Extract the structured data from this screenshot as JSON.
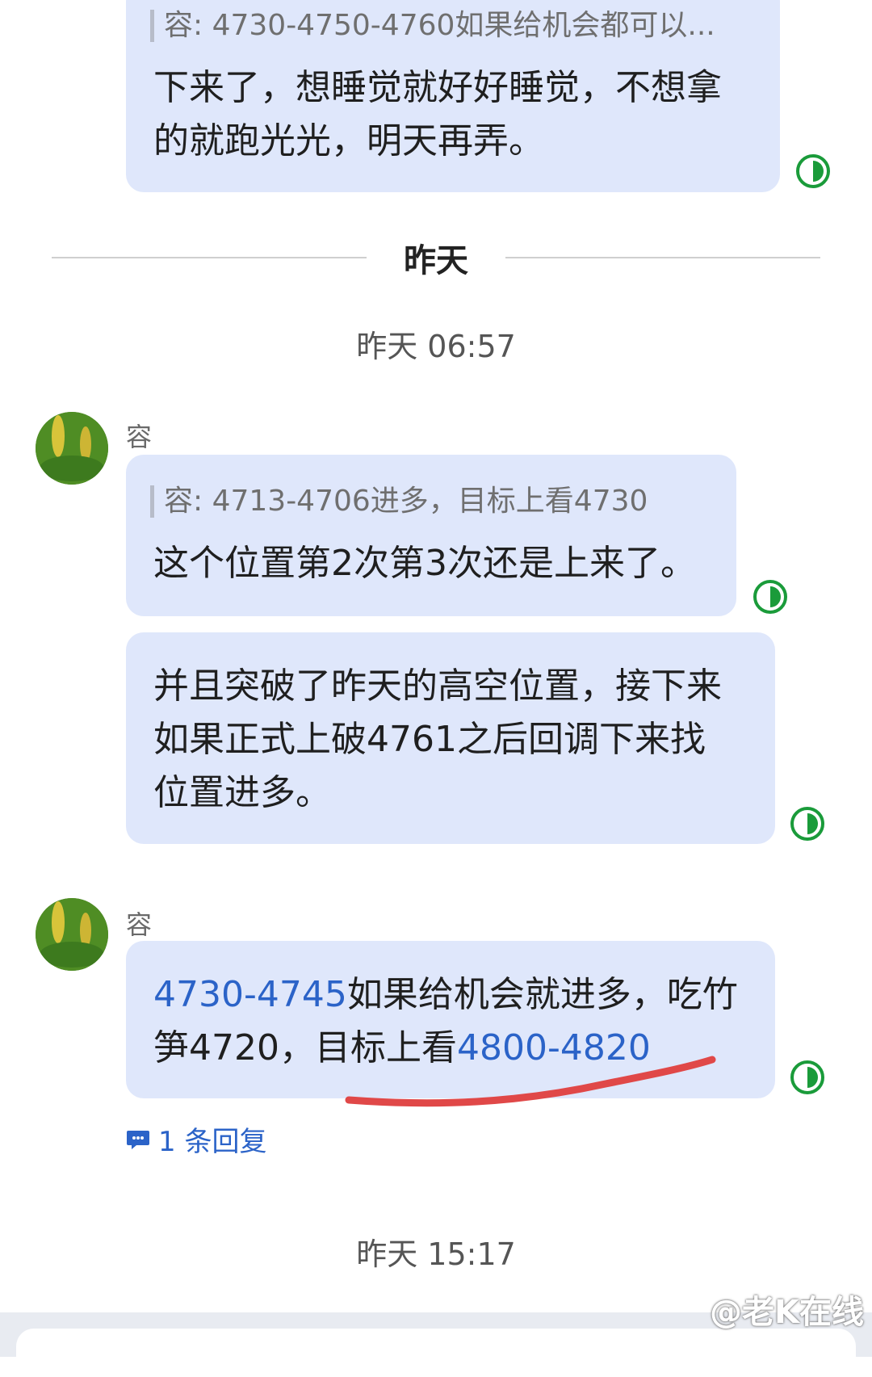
{
  "messages": {
    "top": {
      "quote": "容: 4730-4750-4760如果给机会都可以...",
      "line1": "下来了，想睡觉就好好睡觉，不想拿",
      "line2": "的就跑光光，明天再弄。"
    },
    "divider_label": "昨天",
    "time1": "昨天 06:57",
    "group1": {
      "sender": "容",
      "m1": {
        "quote": "容: 4713-4706进多，目标上看4730",
        "line1": "这个位置第2次第3次还是上来了。"
      },
      "m2": {
        "line1": "并且突破了昨天的高空位置，接下来",
        "line2": "如果正式上破4761之后回调下来找",
        "line3": "位置进多。"
      }
    },
    "group2": {
      "sender": "容",
      "m1": {
        "link1": "4730-4745",
        "text1": "如果给机会就进多，吃竹",
        "text2": "笋4720，目标上看",
        "link2": "4800-4820"
      },
      "reply": "1 条回复"
    },
    "time2": "昨天 15:17"
  },
  "watermark": "@老K在线",
  "colors": {
    "bubble": "#dfe7fb",
    "link": "#2b63c8",
    "read_icon": "#1a9b3a",
    "underline": "#e04848"
  },
  "icons": {
    "read_status": "read-status-icon",
    "reply": "reply-bubble-icon"
  }
}
